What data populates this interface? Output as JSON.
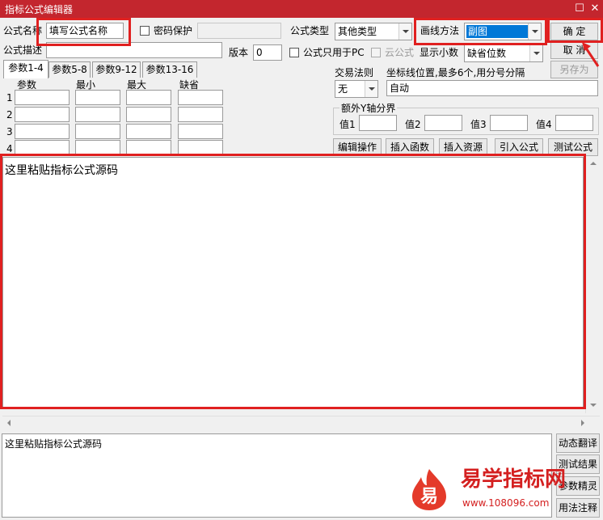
{
  "window": {
    "title": "指标公式编辑器",
    "restore_glyph": "☐",
    "close_glyph": "✕"
  },
  "form": {
    "name_label": "公式名称",
    "name_value": "填写公式名称",
    "password_label": "密码保护",
    "type_label": "公式类型",
    "type_value": "其他类型",
    "draw_label": "画线方法",
    "draw_value": "副图",
    "desc_label": "公式描述",
    "version_label": "版本",
    "version_value": "0",
    "pc_only_label": "公式只用于PC",
    "cloud_label": "云公式",
    "decimals_label": "显示小数",
    "decimals_value": "缺省位数"
  },
  "buttons": {
    "ok": "确  定",
    "cancel": "取  消",
    "save_as": "另存为"
  },
  "tabs": [
    "参数1-4",
    "参数5-8",
    "参数9-12",
    "参数13-16"
  ],
  "params": {
    "headers": [
      "参数",
      "最小",
      "最大",
      "缺省"
    ],
    "rows": [
      "1",
      "2",
      "3",
      "4"
    ]
  },
  "trade": {
    "rule_label": "交易法则",
    "rule_value": "无",
    "axis_label": "坐标线位置,最多6个,用分号分隔",
    "axis_value": "自动"
  },
  "y_axis": {
    "title": "额外Y轴分界",
    "labels": [
      "值1",
      "值2",
      "值3",
      "值4"
    ]
  },
  "actions": [
    "编辑操作",
    "插入函数",
    "插入资源",
    "引入公式",
    "测试公式"
  ],
  "editor": {
    "text": "这里粘贴指标公式源码"
  },
  "output": {
    "text": "这里粘贴指标公式源码"
  },
  "side_buttons": [
    "动态翻译",
    "测试结果",
    "参数精灵",
    "用法注释"
  ],
  "watermark": {
    "brand": "易学指标网",
    "url": "www.108096.com",
    "logo_char": "易"
  },
  "colors": {
    "titlebar": "#c3262e",
    "highlight": "#e02020",
    "selection": "#0078d7",
    "brand": "#d42020"
  }
}
